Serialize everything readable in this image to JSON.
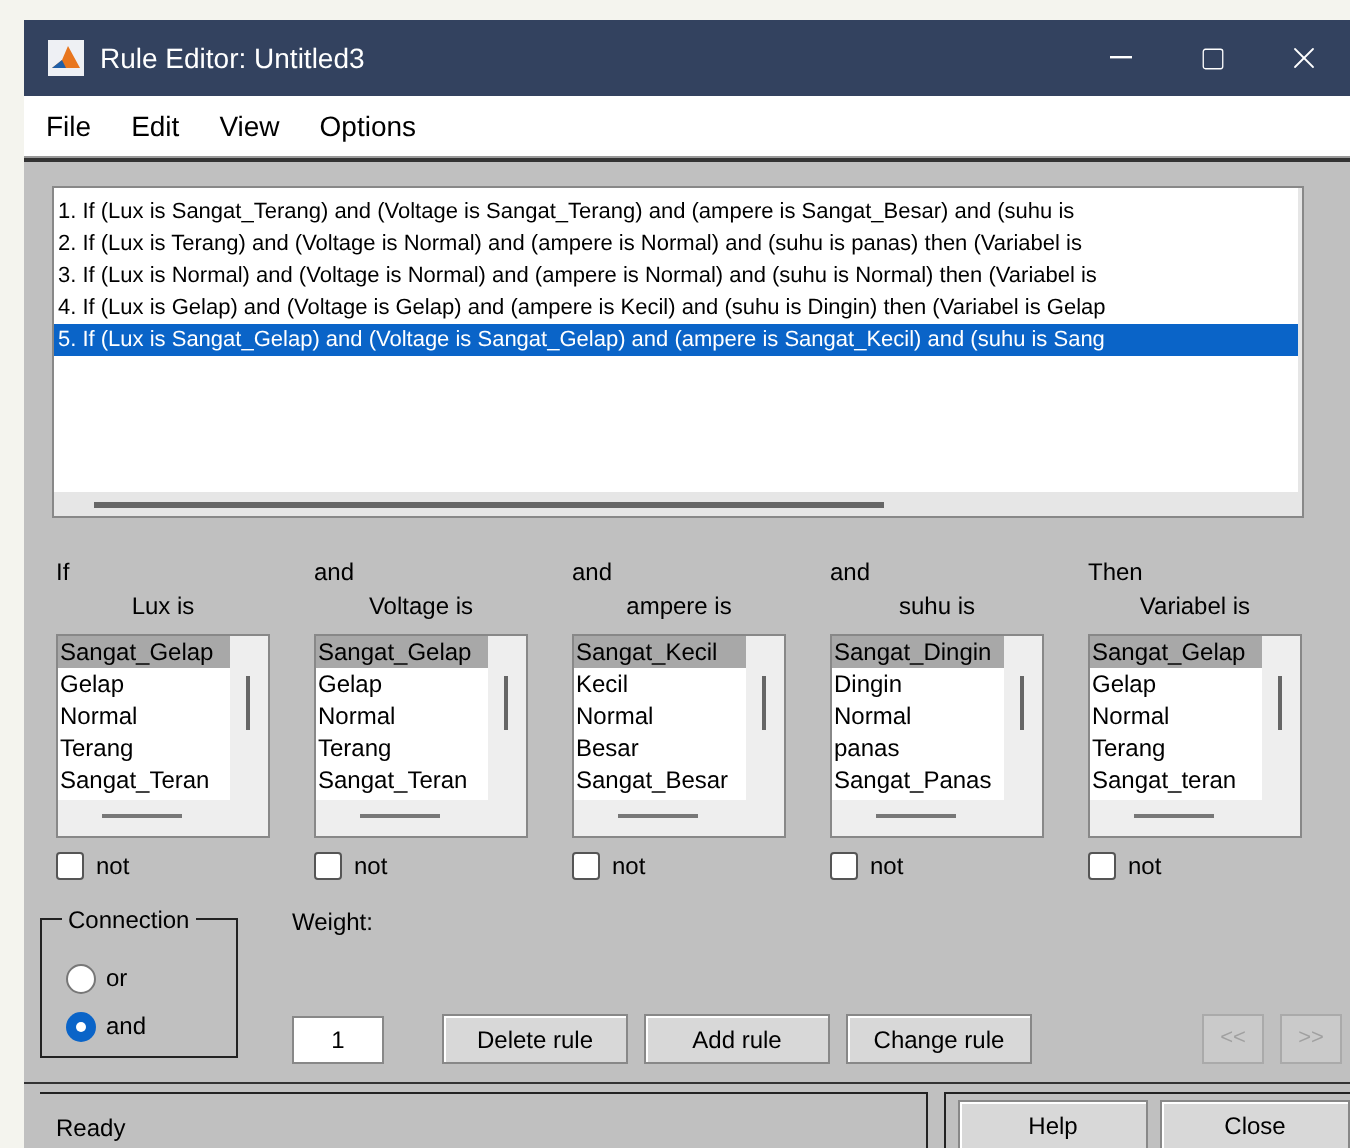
{
  "window": {
    "title": "Rule Editor: Untitled3"
  },
  "menu": [
    "File",
    "Edit",
    "View",
    "Options"
  ],
  "rules": [
    {
      "text": "1. If (Lux is Sangat_Terang) and (Voltage is Sangat_Terang) and (ampere is Sangat_Besar) and (suhu is",
      "selected": false
    },
    {
      "text": "2. If (Lux is Terang) and (Voltage is Normal) and (ampere is Normal) and (suhu is panas) then (Variabel is",
      "selected": false
    },
    {
      "text": "3. If (Lux is Normal) and (Voltage is Normal) and (ampere is Normal) and (suhu is Normal) then (Variabel is",
      "selected": false
    },
    {
      "text": "4. If (Lux is Gelap) and (Voltage is Gelap) and (ampere is Kecil) and (suhu is Dingin) then (Variabel is Gelap",
      "selected": false
    },
    {
      "text": "5. If (Lux is Sangat_Gelap) and (Voltage is Sangat_Gelap) and (ampere is Sangat_Kecil) and (suhu is Sang",
      "selected": true
    }
  ],
  "columns": [
    {
      "connector": "If",
      "label": "Lux is",
      "not": false,
      "not_label": "not",
      "items": [
        {
          "label": "Sangat_Gelap",
          "selected": true
        },
        {
          "label": "Gelap",
          "selected": false
        },
        {
          "label": "Normal",
          "selected": false
        },
        {
          "label": "Terang",
          "selected": false
        },
        {
          "label": "Sangat_Teran",
          "selected": false
        }
      ]
    },
    {
      "connector": "and",
      "label": "Voltage is",
      "not": false,
      "not_label": "not",
      "items": [
        {
          "label": "Sangat_Gelap",
          "selected": true
        },
        {
          "label": "Gelap",
          "selected": false
        },
        {
          "label": "Normal",
          "selected": false
        },
        {
          "label": "Terang",
          "selected": false
        },
        {
          "label": "Sangat_Teran",
          "selected": false
        }
      ]
    },
    {
      "connector": "and",
      "label": "ampere is",
      "not": false,
      "not_label": "not",
      "items": [
        {
          "label": "Sangat_Kecil",
          "selected": true
        },
        {
          "label": "Kecil",
          "selected": false
        },
        {
          "label": "Normal",
          "selected": false
        },
        {
          "label": "Besar",
          "selected": false
        },
        {
          "label": "Sangat_Besar",
          "selected": false
        }
      ]
    },
    {
      "connector": "and",
      "label": "suhu is",
      "not": false,
      "not_label": "not",
      "items": [
        {
          "label": "Sangat_Dingin",
          "selected": true
        },
        {
          "label": "Dingin",
          "selected": false
        },
        {
          "label": "Normal",
          "selected": false
        },
        {
          "label": "panas",
          "selected": false
        },
        {
          "label": "Sangat_Panas",
          "selected": false
        }
      ]
    },
    {
      "connector": "Then",
      "label": "Variabel is",
      "not": false,
      "not_label": "not",
      "items": [
        {
          "label": "Sangat_Gelap",
          "selected": true
        },
        {
          "label": "Gelap",
          "selected": false
        },
        {
          "label": "Normal",
          "selected": false
        },
        {
          "label": "Terang",
          "selected": false
        },
        {
          "label": "Sangat_teran",
          "selected": false
        }
      ]
    }
  ],
  "connection": {
    "title": "Connection",
    "options": [
      {
        "label": "or",
        "selected": false
      },
      {
        "label": "and",
        "selected": true
      }
    ]
  },
  "weight": {
    "label": "Weight:",
    "value": "1"
  },
  "buttons": [
    {
      "label": "Delete rule"
    },
    {
      "label": "Add rule"
    },
    {
      "label": "Change rule"
    }
  ],
  "nav_buttons": [
    {
      "label": "<<",
      "disabled": true
    },
    {
      "label": ">>",
      "disabled": true
    }
  ],
  "status_bar": "Ready",
  "footer_buttons": [
    {
      "label": "Help"
    },
    {
      "label": "Close"
    }
  ]
}
